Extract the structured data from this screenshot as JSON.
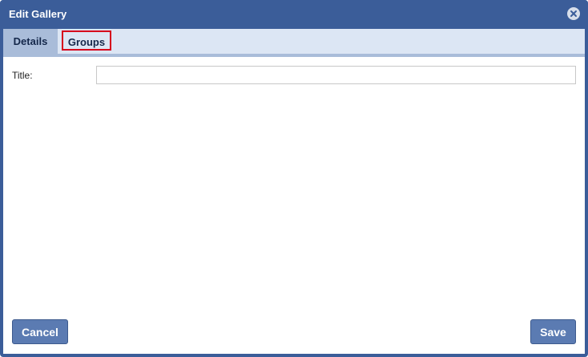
{
  "dialog": {
    "title": "Edit Gallery",
    "close_icon": "close-icon"
  },
  "tabs": [
    {
      "label": "Details",
      "selected": true
    },
    {
      "label": "Groups",
      "selected": false,
      "highlighted": true
    }
  ],
  "form": {
    "title_label": "Title:",
    "title_value": "",
    "title_placeholder": ""
  },
  "buttons": {
    "cancel_label": "Cancel",
    "save_label": "Save"
  },
  "colors": {
    "frame": "#3b5d99",
    "tabbar": "#dce6f4",
    "tab_selected": "#a9bcd9",
    "highlight": "#d6001c",
    "button": "#5b7bb2"
  }
}
